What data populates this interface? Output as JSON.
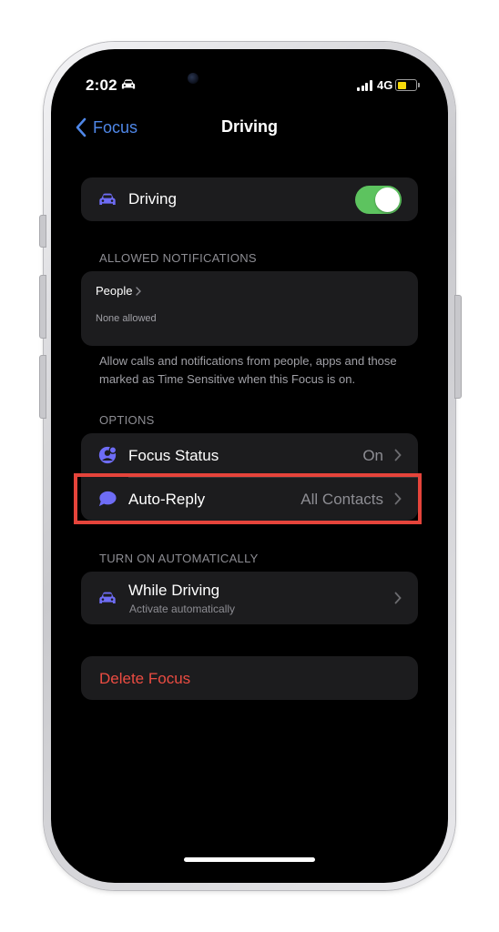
{
  "status_bar": {
    "time": "2:02",
    "network": "4G",
    "driving_icon": "car-icon",
    "battery_color": "#f5d90a"
  },
  "nav": {
    "back_label": "Focus",
    "title": "Driving"
  },
  "focus_toggle": {
    "label": "Driving",
    "icon": "car-icon",
    "enabled": true,
    "accent_color": "#5dc35f"
  },
  "allowed_notifications": {
    "header": "ALLOWED NOTIFICATIONS",
    "people_label": "People",
    "people_value": "None allowed",
    "footer": "Allow calls and notifications from people, apps and those marked as Time Sensitive when this Focus is on."
  },
  "options": {
    "header": "OPTIONS",
    "items": [
      {
        "label": "Focus Status",
        "value": "On",
        "icon": "focus-status-icon"
      },
      {
        "label": "Auto-Reply",
        "value": "All Contacts",
        "icon": "message-bubble-icon"
      }
    ]
  },
  "turn_on_automatically": {
    "header": "TURN ON AUTOMATICALLY",
    "item": {
      "label": "While Driving",
      "sublabel": "Activate automatically",
      "icon": "car-icon"
    }
  },
  "delete_focus": {
    "label": "Delete Focus",
    "color": "#eb4c42"
  },
  "colors": {
    "tint": "#4f87e8",
    "icon_purple": "#6e6cf5",
    "highlight_border": "#e5443b"
  }
}
